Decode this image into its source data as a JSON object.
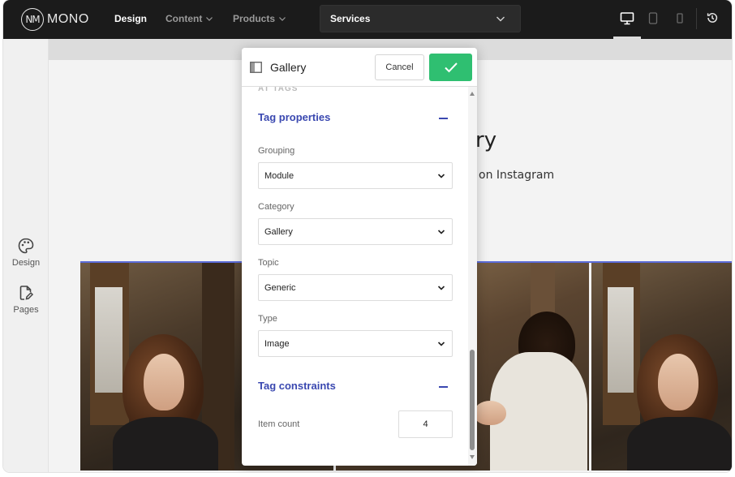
{
  "brand": {
    "name": "MONO",
    "mark": "NM"
  },
  "nav": [
    {
      "label": "Design",
      "active": true,
      "dropdown": false
    },
    {
      "label": "Content",
      "active": false,
      "dropdown": true
    },
    {
      "label": "Products",
      "active": false,
      "dropdown": true
    }
  ],
  "page_selector": {
    "value": "Services"
  },
  "devices": [
    {
      "icon": "desktop-icon",
      "active": true
    },
    {
      "icon": "tablet-icon",
      "active": false
    },
    {
      "icon": "mobile-icon",
      "active": false
    }
  ],
  "history_icon": "history-icon",
  "sidebar": {
    "items": [
      {
        "label": "Design",
        "icon": "palette-icon"
      },
      {
        "label": "Pages",
        "icon": "pages-icon"
      }
    ]
  },
  "canvas": {
    "heading_fragment": "ry",
    "subheading_fragment": "on Instagram"
  },
  "modal": {
    "title": "Gallery",
    "cancel_label": "Cancel",
    "previous_section": "AT TAGS",
    "tag_properties": {
      "title": "Tag properties",
      "fields": [
        {
          "label": "Grouping",
          "value": "Module"
        },
        {
          "label": "Category",
          "value": "Gallery"
        },
        {
          "label": "Topic",
          "value": "Generic"
        },
        {
          "label": "Type",
          "value": "Image"
        }
      ]
    },
    "tag_constraints": {
      "title": "Tag constraints",
      "item_count_label": "Item count",
      "item_count_value": "4"
    }
  },
  "colors": {
    "topbar": "#1b1b1b",
    "accent": "#3a48b0",
    "confirm": "#2fbf71",
    "selection": "#5b6bd8"
  }
}
